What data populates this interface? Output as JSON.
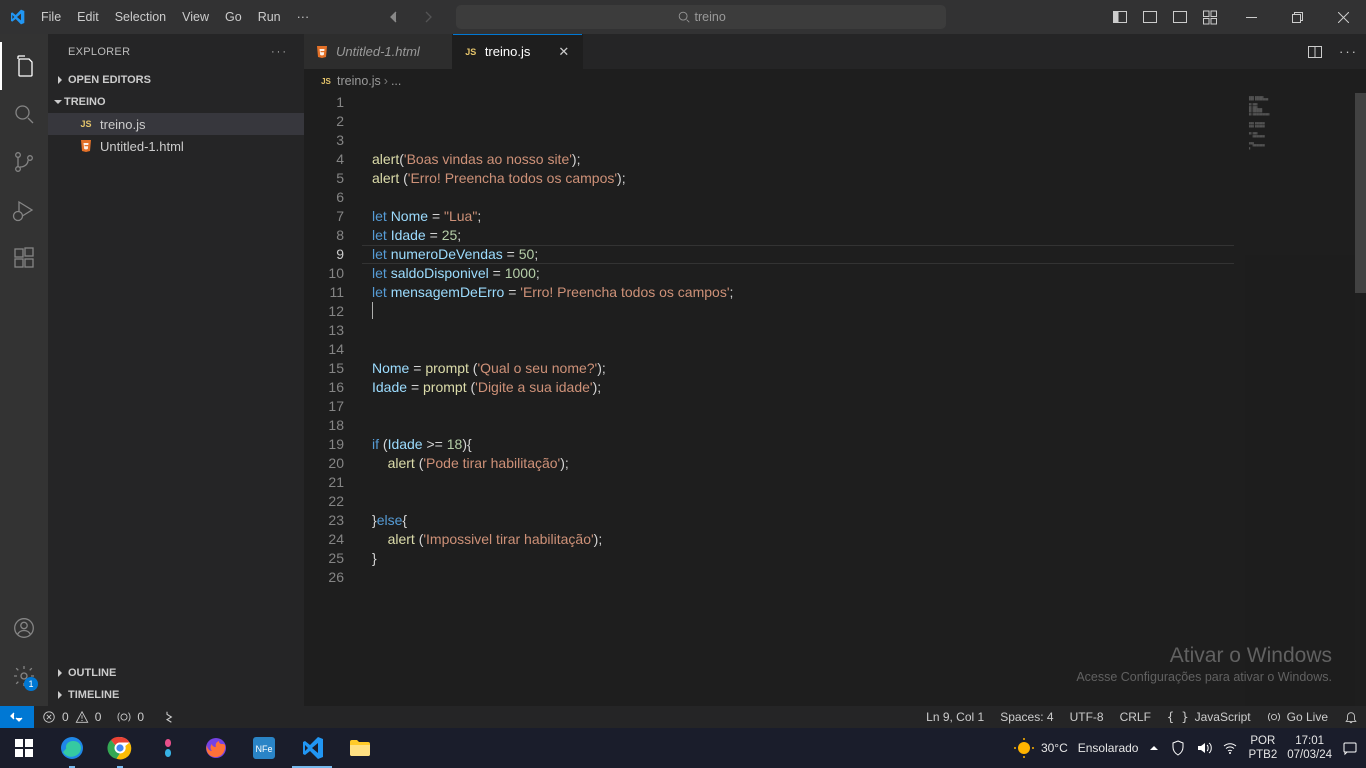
{
  "menu": {
    "file": "File",
    "edit": "Edit",
    "selection": "Selection",
    "view": "View",
    "go": "Go",
    "run": "Run"
  },
  "search": {
    "value": "treino"
  },
  "explorer": {
    "title": "EXPLORER",
    "openEditors": "OPEN EDITORS",
    "folder": "TREINO",
    "items": [
      {
        "label": "treino.js",
        "type": "js"
      },
      {
        "label": "Untitled-1.html",
        "type": "html"
      }
    ],
    "outline": "OUTLINE",
    "timeline": "TIMELINE"
  },
  "tabs": [
    {
      "label": "Untitled-1.html",
      "type": "html",
      "italic": true
    },
    {
      "label": "treino.js",
      "type": "js",
      "active": true
    }
  ],
  "breadcrumb": {
    "file": "treino.js",
    "rest": "..."
  },
  "code": {
    "lineCount": 26
  },
  "watermark": {
    "l1": "Ativar o Windows",
    "l2": "Acesse Configurações para ativar o Windows."
  },
  "status": {
    "errors": "0",
    "warnings": "0",
    "ports": "0",
    "lncol": "Ln 9, Col 1",
    "spaces": "Spaces: 4",
    "enc": "UTF-8",
    "eol": "CRLF",
    "lang": "JavaScript",
    "golive": "Go Live"
  },
  "taskbar": {
    "weather_temp": "30°C",
    "weather_text": "Ensolarado",
    "lang1": "POR",
    "lang2": "PTB2",
    "time": "17:01",
    "date": "07/03/24"
  },
  "settings_badge": "1"
}
